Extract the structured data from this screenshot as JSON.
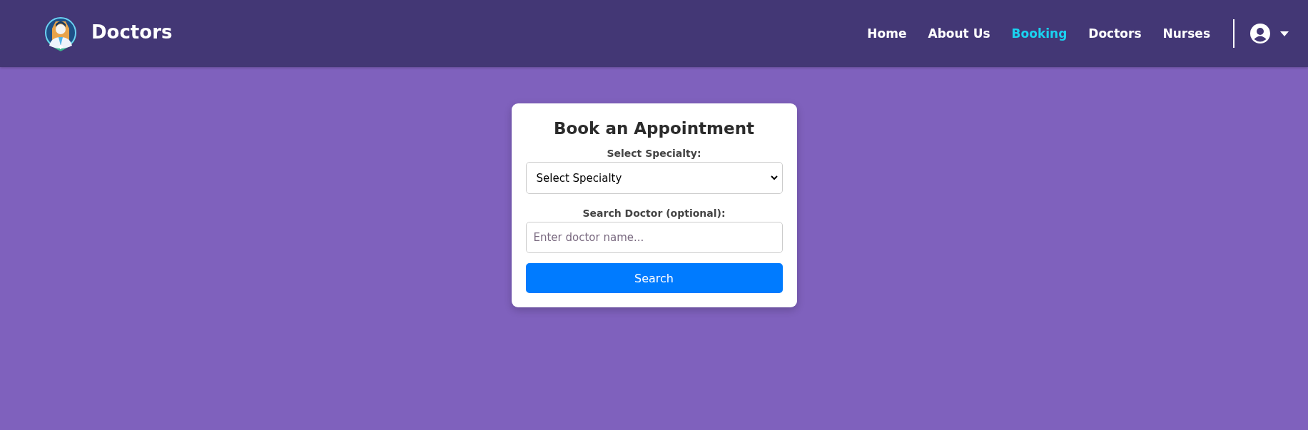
{
  "navbar": {
    "brand": "Doctors",
    "links": [
      {
        "label": "Home",
        "selected": false
      },
      {
        "label": "About Us",
        "selected": false
      },
      {
        "label": "Booking",
        "selected": true
      },
      {
        "label": "Doctors",
        "selected": false
      },
      {
        "label": "Nurses",
        "selected": false
      }
    ]
  },
  "booking_form": {
    "title": "Book an Appointment",
    "specialty_label": "Select Specialty:",
    "specialty_select": {
      "value": "Select Specialty"
    },
    "doctor_label": "Search Doctor (optional):",
    "doctor_field": {
      "placeholder": "Enter doctor name..."
    },
    "search_button": "Search"
  }
}
